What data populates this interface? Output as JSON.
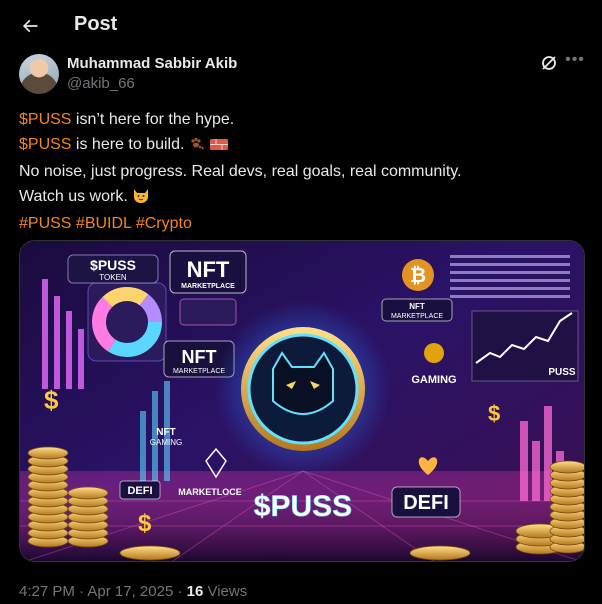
{
  "header": {
    "title": "Post"
  },
  "author": {
    "name": "Muhammad Sabbir Akib",
    "handle": "@akib_66"
  },
  "tweet": {
    "line1": {
      "ticker": "$PUSS",
      "rest": " isn’t here for the hype."
    },
    "line2": {
      "ticker": "$PUSS",
      "rest": " is here to build."
    },
    "line3": "No noise, just progress. Real devs, real goals, real community.",
    "line4": "Watch us work.",
    "hashtags": [
      "#PUSS",
      "#BUIDL",
      "#Crypto"
    ]
  },
  "media": {
    "puss_token_ticker": "$PUSS",
    "puss_token_sub": "TOKEN",
    "nft_marketplace_top": {
      "title": "NFT",
      "sub": "MARKETPLACE"
    },
    "nft_marketplace_left": {
      "title": "NFT",
      "sub": "MARKETPLACE"
    },
    "nft_marketplace_right": {
      "title": "NFT",
      "sub": "MARKETPLACE"
    },
    "nft_gaming": {
      "title": "NFT",
      "sub": "GAMING"
    },
    "gaming_label": "GAMING",
    "puss_chart_label": "PUSS",
    "defi_left": "DEFI",
    "marketplace_bottom": "MARKETLOCE",
    "center_ticker": "$PUSS",
    "defi_right": "DEFI",
    "dollar_sign": "$",
    "bitcoin_sign": "₿"
  },
  "meta": {
    "time": "4:27 PM",
    "separator": " · ",
    "date": "Apr 17, 2025",
    "views_count": "16",
    "views_label": " Views"
  },
  "colors": {
    "accent": "#f4861f",
    "secondary_text": "#71767b",
    "primary_text": "#e7e9ea",
    "background": "#000000"
  }
}
